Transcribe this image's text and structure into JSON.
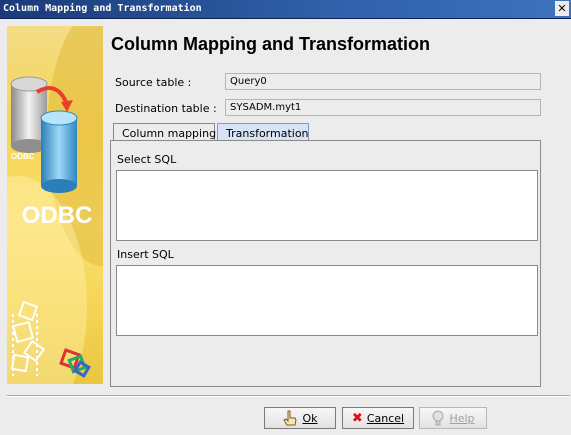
{
  "window": {
    "title": "Column Mapping and Transformation"
  },
  "sidebar": {
    "brand_text": "ODBC",
    "icon_text": "ODBC"
  },
  "header": {
    "title": "Column Mapping and Transformation"
  },
  "source": {
    "label": "Source table :",
    "value": "Query0"
  },
  "destination": {
    "label": "Destination table :",
    "value": "SYSADM.myt1"
  },
  "tabs": [
    {
      "label": "Column mapping",
      "active": false
    },
    {
      "label": "Transformation",
      "active": true
    }
  ],
  "transformation": {
    "select_label": "Select SQL",
    "select_value": "",
    "insert_label": "Insert SQL",
    "insert_value": ""
  },
  "buttons": {
    "ok": "Ok",
    "cancel": "Cancel",
    "help": "Help"
  },
  "colors": {
    "titlebar": "#2f5fa8",
    "sidebar": "#f6d553",
    "active_tab": "#d6e4f6"
  }
}
